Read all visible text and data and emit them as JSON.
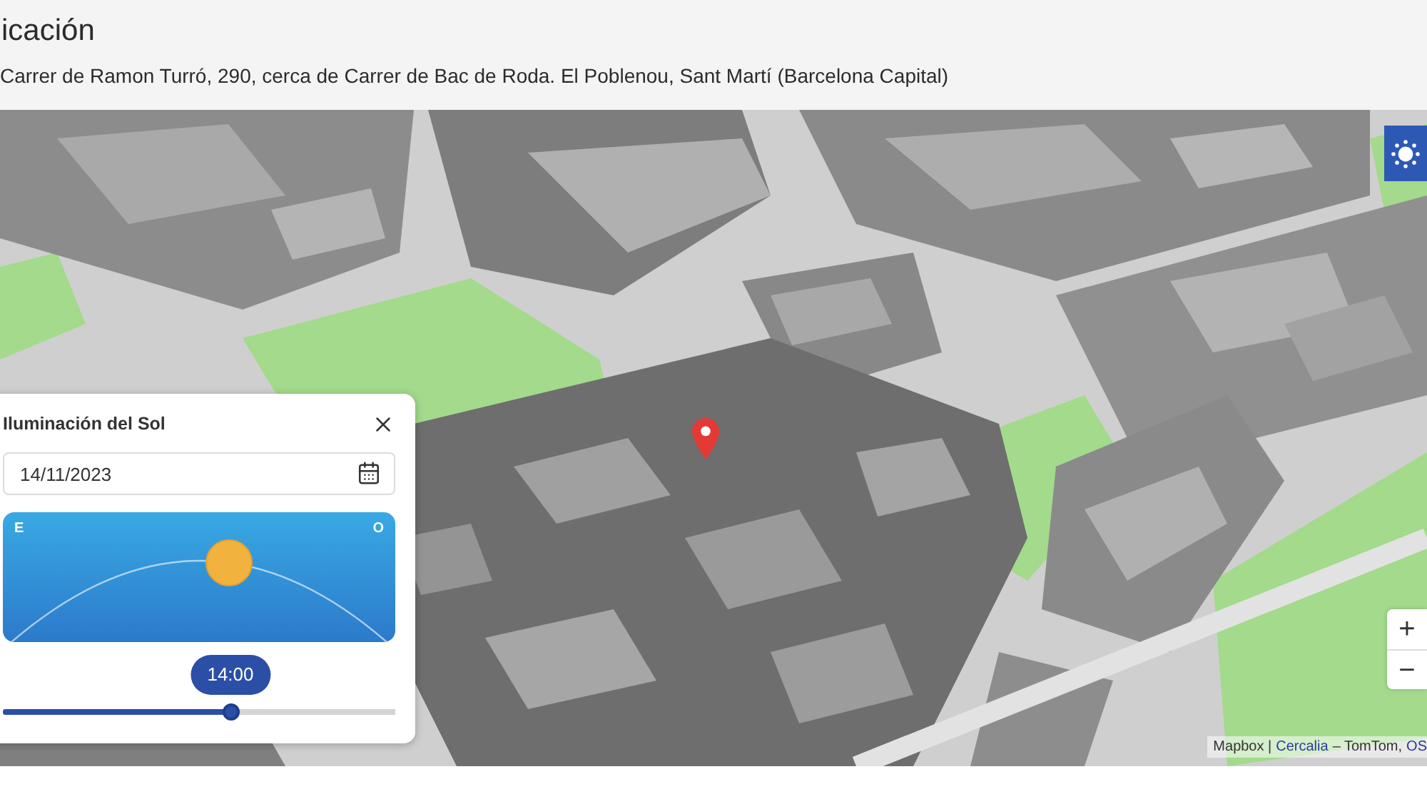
{
  "header": {
    "title": "icación",
    "address": "Carrer de Ramon Turró, 290, cerca de Carrer de Bac de Roda. El Poblenou, Sant Martí (Barcelona Capital)"
  },
  "map": {
    "sun_toggle": {
      "active": true
    },
    "zoom_controls": [
      {
        "label": "+"
      },
      {
        "label": "−"
      }
    ],
    "attribution": [
      {
        "kind": "text",
        "text": "Mapbox |"
      },
      {
        "kind": "link",
        "text": "Cercalia"
      },
      {
        "kind": "text",
        "text": "– TomTom,"
      },
      {
        "kind": "link",
        "text": "OS"
      }
    ]
  },
  "sun_panel": {
    "title": "Iluminación del Sol",
    "date_field": {
      "value": "14/11/2023"
    },
    "sky": {
      "east_label": "E",
      "west_label": "O"
    },
    "time_slider": {
      "reading": "14:00",
      "level": 0.58
    }
  }
}
